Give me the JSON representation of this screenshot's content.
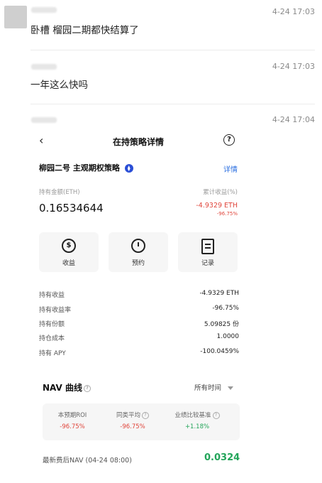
{
  "comments": [
    {
      "text": "卧槽 榴园二期都快结算了",
      "time": "4-24 17:03"
    },
    {
      "text": "一年这么快吗",
      "time": "4-24 17:03"
    },
    {
      "time": "4-24 17:04"
    }
  ],
  "screen": {
    "title": "在持策略详情",
    "back_icon": "back-arrow-icon",
    "help_icon": "question-circle-icon",
    "strategy_name": "柳园二号 主观期权策略",
    "detail_link": "详情",
    "holding_amount_label": "持有金额(ETH)",
    "holding_amount_value": "0.16534644",
    "cumulative_return_label": "累计收益(%)",
    "cumulative_return_value": "-4.9329 ETH",
    "cumulative_return_pct": "-96.75%",
    "buttons": [
      {
        "label": "收益",
        "icon": "dollar-refresh-icon"
      },
      {
        "label": "预约",
        "icon": "clock-icon"
      },
      {
        "label": "记录",
        "icon": "clipboard-icon"
      }
    ],
    "details": [
      {
        "label": "持有收益",
        "value": "-4.9329 ETH"
      },
      {
        "label": "持有收益率",
        "value": "-96.75%"
      },
      {
        "label": "持有份额",
        "value": "5.09825 份"
      },
      {
        "label": "持仓成本",
        "value": "1.0000"
      },
      {
        "label": "持有 APY",
        "value": "-100.0459%"
      }
    ],
    "nav_title": "NAV 曲线",
    "time_filter": "所有时间",
    "stats": [
      {
        "label": "本预期ROI",
        "value": "-96.75%",
        "color": "#e0453b"
      },
      {
        "label": "同类平均",
        "value": "-96.75%",
        "color": "#e0453b"
      },
      {
        "label": "业绩比较基准",
        "value": "+1.18%",
        "color": "#23a55a"
      }
    ],
    "latest_nav_label": "最新费后NAV (04-24 08:00)",
    "latest_nav_value": "0.0324"
  }
}
